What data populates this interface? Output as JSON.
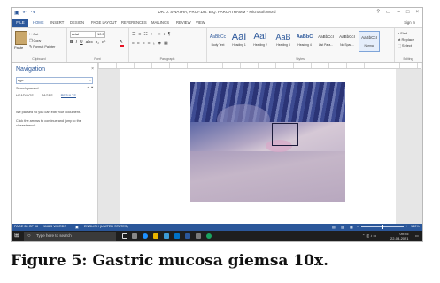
{
  "window": {
    "title": "DR. J. SWATHA, PROF.DR. B.Q. PARUATHAMM - Microsoft Word",
    "qat_icons": [
      "save-icon",
      "undo-icon",
      "redo-icon"
    ],
    "controls": {
      "help": "?",
      "ribbon_options": "▭",
      "minimize": "–",
      "restore": "□",
      "close": "×"
    }
  },
  "tabs": [
    "FILE",
    "HOME",
    "INSERT",
    "DESIGN",
    "PAGE LAYOUT",
    "REFERENCES",
    "MAILINGS",
    "REVIEW",
    "VIEW"
  ],
  "signin": "Sign in",
  "ribbon": {
    "clipboard": {
      "paste": "Paste",
      "cut": "Cut",
      "copy": "Copy",
      "format_painter": "Format Painter",
      "label": "Clipboard"
    },
    "font": {
      "name": "Arial",
      "size": "10.5",
      "label": "Font",
      "buttons": [
        "B",
        "I",
        "U",
        "abc",
        "x₂",
        "x²"
      ]
    },
    "paragraph": {
      "label": "Paragraph"
    },
    "styles": {
      "label": "Styles",
      "items": [
        {
          "sample": "AaBbCc",
          "name": "Body Text"
        },
        {
          "sample": "AaI",
          "name": "Heading 1"
        },
        {
          "sample": "AaI",
          "name": "Heading 2"
        },
        {
          "sample": "AaB",
          "name": "Heading 3"
        },
        {
          "sample": "AaBbC",
          "name": "Heading 4"
        },
        {
          "sample": "AaBbCcI",
          "name": "List Para..."
        },
        {
          "sample": "AaBbCcI",
          "name": "No Spac..."
        },
        {
          "sample": "AaBbCcI",
          "name": "Normal"
        }
      ]
    },
    "editing": {
      "find": "Find",
      "replace": "Replace",
      "select": "Select",
      "label": "Editing"
    }
  },
  "navigation": {
    "title": "Navigation",
    "close": "×",
    "search_value": "age",
    "search_paused": "Search paused",
    "tabs": [
      "HEADINGS",
      "PAGES",
      "RESULTS"
    ],
    "message1": "We paused so you can edit your document.",
    "message2": "Click the arrows to continue and jump to the closest result."
  },
  "statusbar": {
    "page": "PAGE 28 OF 96",
    "words": "11625 WORDS",
    "language": "ENGLISH (UNITED STATES)",
    "zoom": "140%"
  },
  "taskbar": {
    "search_placeholder": "Type here to search",
    "time": "09:25",
    "date": "22-03-2021"
  },
  "caption": "Figure 5: Gastric mucosa giemsa 10x.",
  "colors": {
    "word_blue": "#2b579a",
    "taskbar": "#1e1e1e",
    "font_color_red": "#e81123"
  }
}
